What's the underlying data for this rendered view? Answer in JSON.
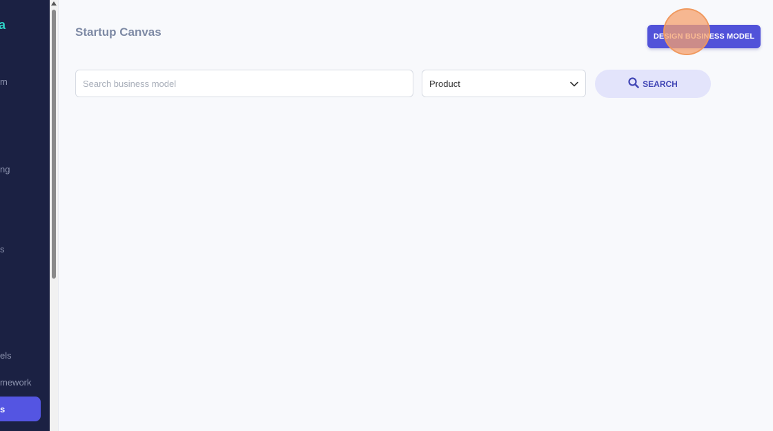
{
  "sidebar": {
    "logo_fragment": "a",
    "items": [
      {
        "label": "m"
      },
      {
        "label": "ng"
      },
      {
        "label": "s"
      },
      {
        "label": "els"
      },
      {
        "label": "mework"
      }
    ],
    "active_item": {
      "label": "s"
    }
  },
  "header": {
    "title": "Startup Canvas",
    "design_button_label": "DESIGN BUSINESS MODEL"
  },
  "search": {
    "placeholder": "Search business model",
    "value": "",
    "category_selected": "Product",
    "button_label": "SEARCH"
  },
  "colors": {
    "sidebar_bg": "#1b2143",
    "accent": "#5152d9",
    "search_button_bg": "#e3e4fb",
    "logo": "#2ed3c6"
  },
  "icons": {
    "search": "search-icon",
    "dropdown": "chevron-down-icon"
  }
}
